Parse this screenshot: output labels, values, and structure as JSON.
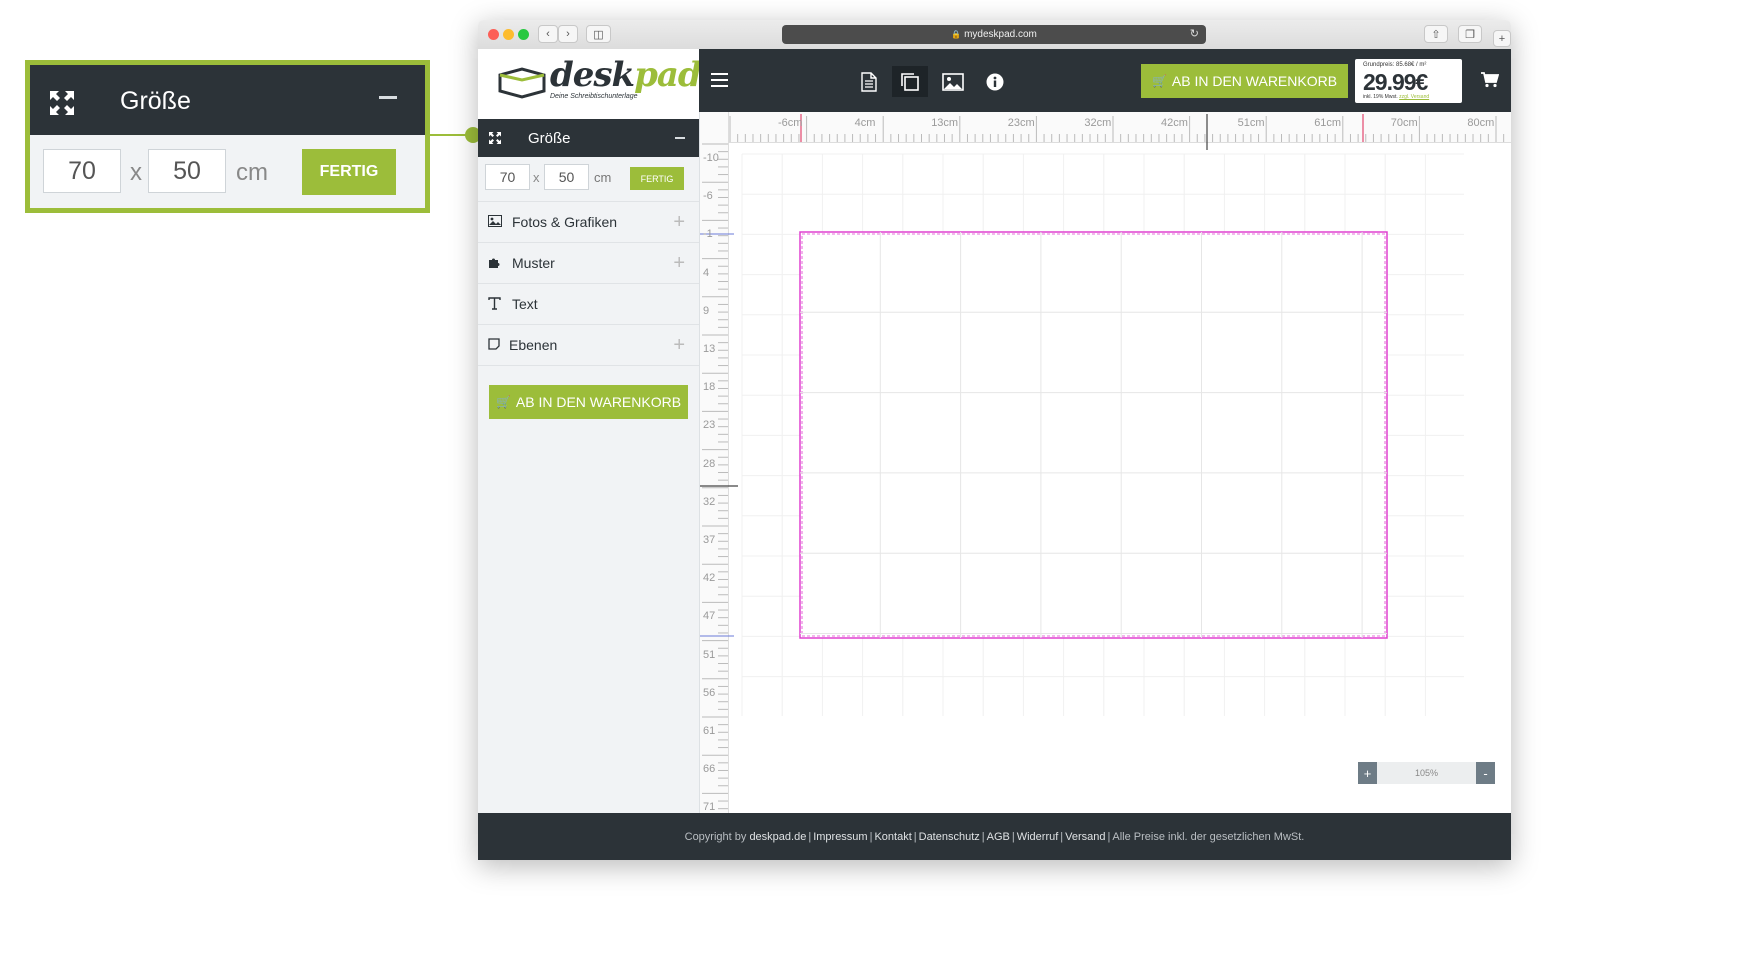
{
  "callout": {
    "title": "Größe",
    "width": "70",
    "x": "x",
    "height": "50",
    "unit": "cm",
    "done_label": "FERTIG"
  },
  "browser": {
    "url": "mydeskpad.com"
  },
  "logo": {
    "part1": "desk",
    "part2": "pad",
    "tagline": "Deine Schreibtischunterlage"
  },
  "sidebar": {
    "size_section": {
      "title": "Größe",
      "width": "70",
      "x": "x",
      "height": "50",
      "unit": "cm",
      "done_label": "FERTIG"
    },
    "items": [
      {
        "label": "Fotos & Grafiken",
        "icon": "image-icon",
        "expandable": true
      },
      {
        "label": "Muster",
        "icon": "puzzle-icon",
        "expandable": true
      },
      {
        "label": "Text",
        "icon": "text-icon",
        "expandable": false
      },
      {
        "label": "Ebenen",
        "icon": "layers-icon",
        "expandable": true
      }
    ],
    "cart_label": "AB IN DEN WARENKORB"
  },
  "toolbar": {
    "tools": [
      "document-icon",
      "copy-icon",
      "image-icon",
      "info-icon"
    ],
    "active_tool": "copy-icon",
    "cart_label": "AB IN DEN WARENKORB",
    "price": {
      "base": "Grundpreis: 85.68€ / m²",
      "value": "29.99€",
      "tax": "inkl. 19% Mwst.",
      "shipping": "zzgl. Versand"
    }
  },
  "canvas": {
    "ruler_top": [
      "-6cm",
      "4cm",
      "13cm",
      "23cm",
      "32cm",
      "42cm",
      "51cm",
      "61cm",
      "70cm",
      "80cm"
    ],
    "ruler_left": [
      "-10",
      "-6",
      "-1",
      "4",
      "9",
      "13",
      "18",
      "23",
      "28",
      "32",
      "37",
      "42",
      "47",
      "51",
      "56",
      "61",
      "66",
      "71"
    ],
    "zoom": "105%",
    "zoom_in": "+",
    "zoom_out": "-"
  },
  "footer": {
    "prefix": "Copyright by ",
    "links": [
      "deskpad.de",
      "Impressum",
      "Kontakt",
      "Datenschutz",
      "AGB",
      "Widerruf",
      "Versand"
    ],
    "suffix": "Alle Preise inkl. der gesetzlichen MwSt."
  },
  "colors": {
    "accent": "#9cbd3a",
    "dark": "#2c3338",
    "design_border": "#e040d0"
  }
}
